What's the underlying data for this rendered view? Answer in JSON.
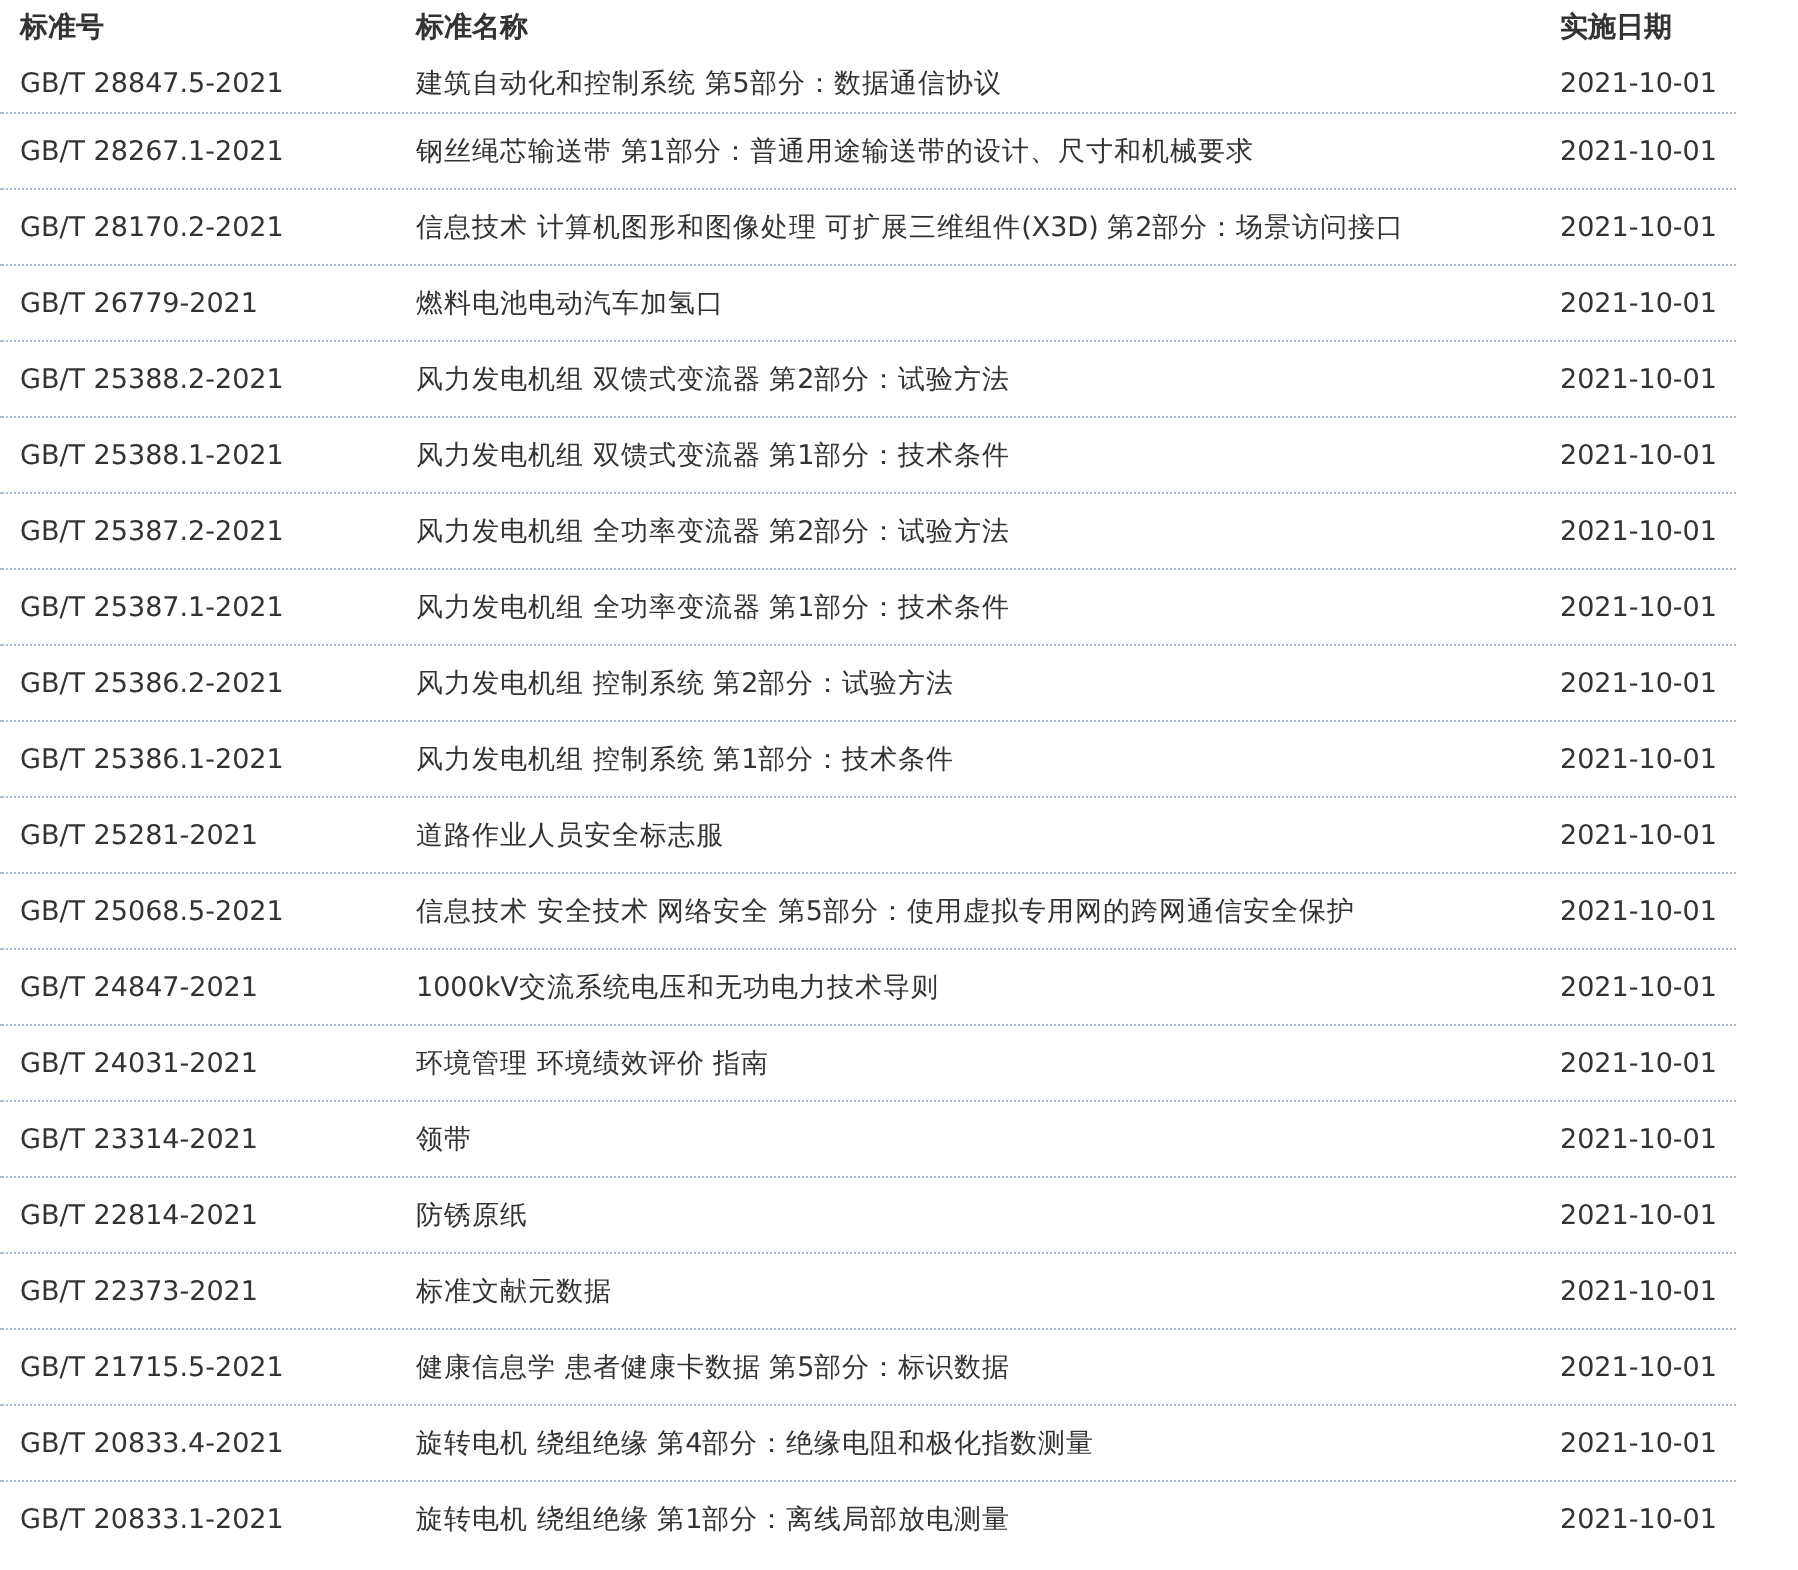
{
  "table": {
    "columns": [
      "标准号",
      "标准名称",
      "实施日期"
    ],
    "rows": [
      {
        "code": "GB/T 28847.5-2021",
        "name": "建筑自动化和控制系统 第5部分：数据通信协议",
        "date": "2021-10-01"
      },
      {
        "code": "GB/T 28267.1-2021",
        "name": "钢丝绳芯输送带 第1部分：普通用途输送带的设计、尺寸和机械要求",
        "date": "2021-10-01"
      },
      {
        "code": "GB/T 28170.2-2021",
        "name": "信息技术 计算机图形和图像处理 可扩展三维组件(X3D) 第2部分：场景访问接口",
        "date": "2021-10-01"
      },
      {
        "code": "GB/T 26779-2021",
        "name": "燃料电池电动汽车加氢口",
        "date": "2021-10-01"
      },
      {
        "code": "GB/T 25388.2-2021",
        "name": "风力发电机组 双馈式变流器 第2部分：试验方法",
        "date": "2021-10-01"
      },
      {
        "code": "GB/T 25388.1-2021",
        "name": "风力发电机组 双馈式变流器 第1部分：技术条件",
        "date": "2021-10-01"
      },
      {
        "code": "GB/T 25387.2-2021",
        "name": "风力发电机组 全功率变流器 第2部分：试验方法",
        "date": "2021-10-01"
      },
      {
        "code": "GB/T 25387.1-2021",
        "name": "风力发电机组 全功率变流器 第1部分：技术条件",
        "date": "2021-10-01"
      },
      {
        "code": "GB/T 25386.2-2021",
        "name": "风力发电机组 控制系统 第2部分：试验方法",
        "date": "2021-10-01"
      },
      {
        "code": "GB/T 25386.1-2021",
        "name": "风力发电机组 控制系统 第1部分：技术条件",
        "date": "2021-10-01"
      },
      {
        "code": "GB/T 25281-2021",
        "name": "道路作业人员安全标志服",
        "date": "2021-10-01"
      },
      {
        "code": "GB/T 25068.5-2021",
        "name": "信息技术 安全技术 网络安全 第5部分：使用虚拟专用网的跨网通信安全保护",
        "date": "2021-10-01"
      },
      {
        "code": "GB/T 24847-2021",
        "name": "1000kV交流系统电压和无功电力技术导则",
        "date": "2021-10-01"
      },
      {
        "code": "GB/T 24031-2021",
        "name": "环境管理 环境绩效评价 指南",
        "date": "2021-10-01"
      },
      {
        "code": "GB/T 23314-2021",
        "name": "领带",
        "date": "2021-10-01"
      },
      {
        "code": "GB/T 22814-2021",
        "name": "防锈原纸",
        "date": "2021-10-01"
      },
      {
        "code": "GB/T 22373-2021",
        "name": "标准文献元数据",
        "date": "2021-10-01"
      },
      {
        "code": "GB/T 21715.5-2021",
        "name": "健康信息学 患者健康卡数据 第5部分：标识数据",
        "date": "2021-10-01"
      },
      {
        "code": "GB/T 20833.4-2021",
        "name": "旋转电机 绕组绝缘 第4部分：绝缘电阻和极化指数测量",
        "date": "2021-10-01"
      },
      {
        "code": "GB/T 20833.1-2021",
        "name": "旋转电机 绕组绝缘 第1部分：离线局部放电测量",
        "date": "2021-10-01"
      }
    ]
  }
}
